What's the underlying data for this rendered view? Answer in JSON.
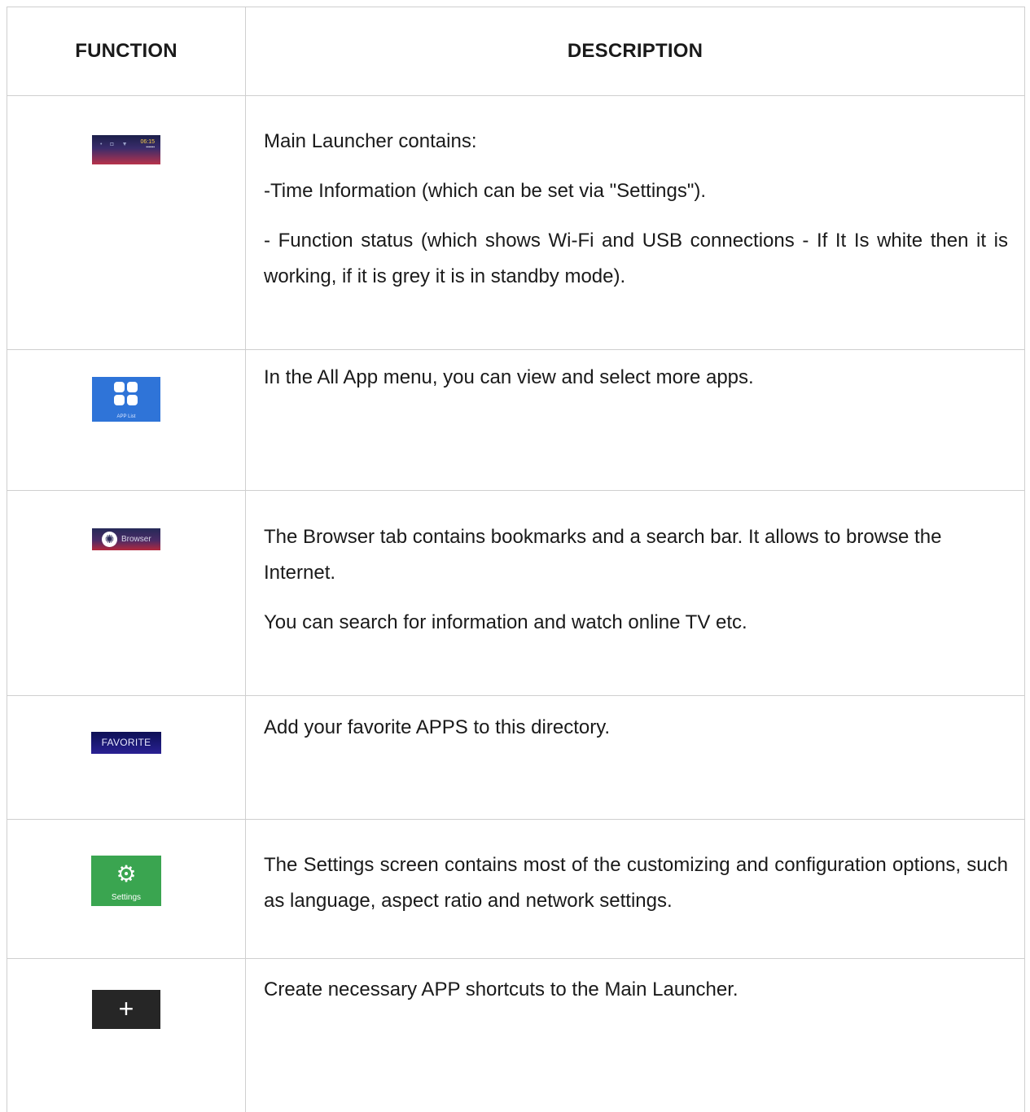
{
  "table": {
    "headers": {
      "function": "FUNCTION",
      "description": "DESCRIPTION"
    },
    "rows": [
      {
        "icon": "launcher-thumbnail",
        "paragraphs": [
          "Main Launcher contains:",
          "-Time Information (which can be set via \"Settings\").",
          "- Function status (which shows Wi-Fi and USB connections - If It Is white then it is working, if it is grey it is in standby mode)."
        ]
      },
      {
        "icon": "app-list-thumbnail",
        "icon_caption": "APP List",
        "paragraphs": [
          "In the All App menu, you can view and select more apps."
        ]
      },
      {
        "icon": "browser-thumbnail",
        "icon_caption": "Browser",
        "paragraphs": [
          "The Browser tab contains bookmarks and a search bar. It allows to browse the Internet.",
          "You can search for information and watch online TV etc."
        ]
      },
      {
        "icon": "favorite-thumbnail",
        "icon_caption": "FAVORITE",
        "paragraphs": [
          "Add your favorite APPS to this directory."
        ]
      },
      {
        "icon": "settings-thumbnail",
        "icon_caption": "Settings",
        "paragraphs": [
          "The Settings screen contains most of the customizing and configuration options, such as language, aspect ratio and network settings."
        ]
      },
      {
        "icon": "add-shortcut-thumbnail",
        "paragraphs": [
          "Create necessary APP shortcuts to the Main Launcher."
        ]
      }
    ]
  },
  "colors": {
    "border": "#cfcfcf",
    "text": "#1a1a1a",
    "apps_tile": "#2f74d8",
    "settings_tile": "#3aa550",
    "add_tile": "#262626",
    "favorite_tile": "#1d1a7a"
  }
}
